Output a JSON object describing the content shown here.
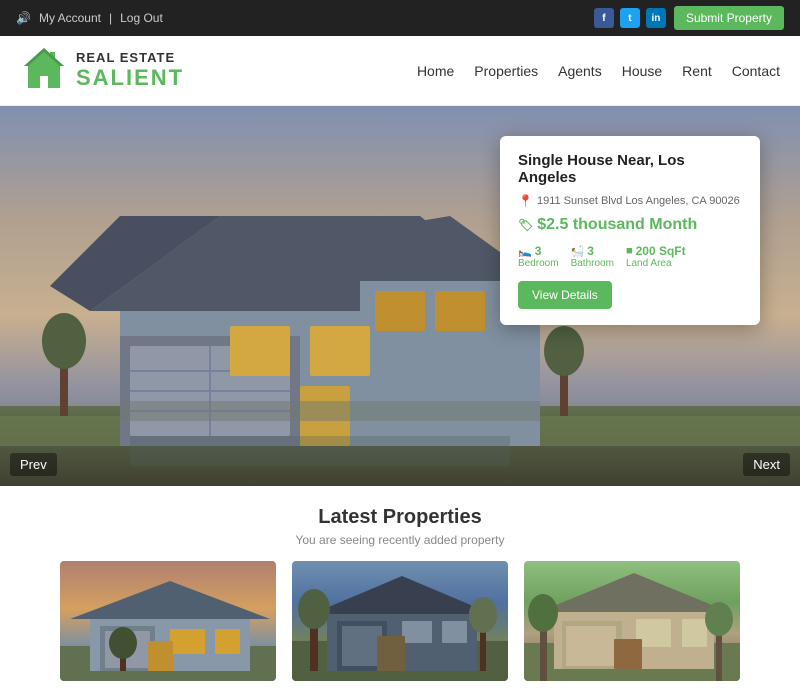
{
  "topbar": {
    "account": "My Account",
    "separator": "|",
    "logout": "Log Out",
    "submit_label": "Submit Property",
    "social": [
      "f",
      "t",
      "in"
    ]
  },
  "header": {
    "logo_top": "REAL ESTATE",
    "logo_bottom": "SALIENT",
    "nav_items": [
      "Home",
      "Properties",
      "Agents",
      "House",
      "Rent",
      "Contact"
    ]
  },
  "hero": {
    "prev": "Prev",
    "next": "Next"
  },
  "property_card": {
    "title": "Single House Near, Los Angeles",
    "address": "1911 Sunset Blvd Los Angeles, CA 90026",
    "price": "$2.5 thousand Month",
    "bedrooms_count": "3",
    "bedrooms_label": "Bedroom",
    "bathrooms_count": "3",
    "bathrooms_label": "Bathroom",
    "area_count": "200 SqFt",
    "area_label": "Land Area",
    "view_btn": "View Details"
  },
  "latest": {
    "title": "Latest Properties",
    "subtitle": "You are seeing recently added property"
  }
}
